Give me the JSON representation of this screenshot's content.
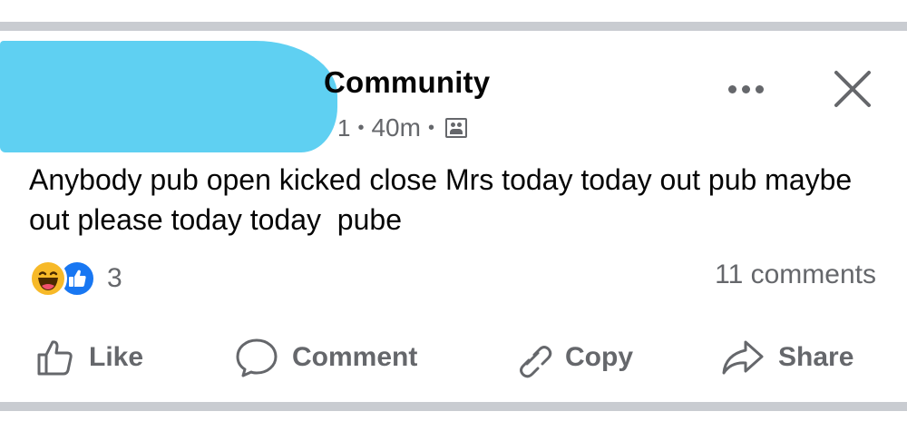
{
  "post": {
    "group_name": "Community",
    "time": "40m",
    "author_fragment": "1",
    "text": "Anybody pub open kicked close Mrs today today out pub maybe out please today today  pube",
    "audience_icon": "group-audience-icon"
  },
  "header_icons": [
    "more-options-icon",
    "close-icon"
  ],
  "reactions": {
    "types": [
      "haha",
      "like"
    ],
    "count": "3"
  },
  "comments_label": "11 comments",
  "actions": {
    "like": "Like",
    "comment": "Comment",
    "copy": "Copy",
    "share": "Share"
  },
  "colors": {
    "secondary_text": "#65676b",
    "primary_text": "#050505",
    "like_blue": "#1877f2",
    "haha_yellow": "#f7b928",
    "redaction": "#5fd0f2",
    "divider": "#c9ccd1"
  }
}
